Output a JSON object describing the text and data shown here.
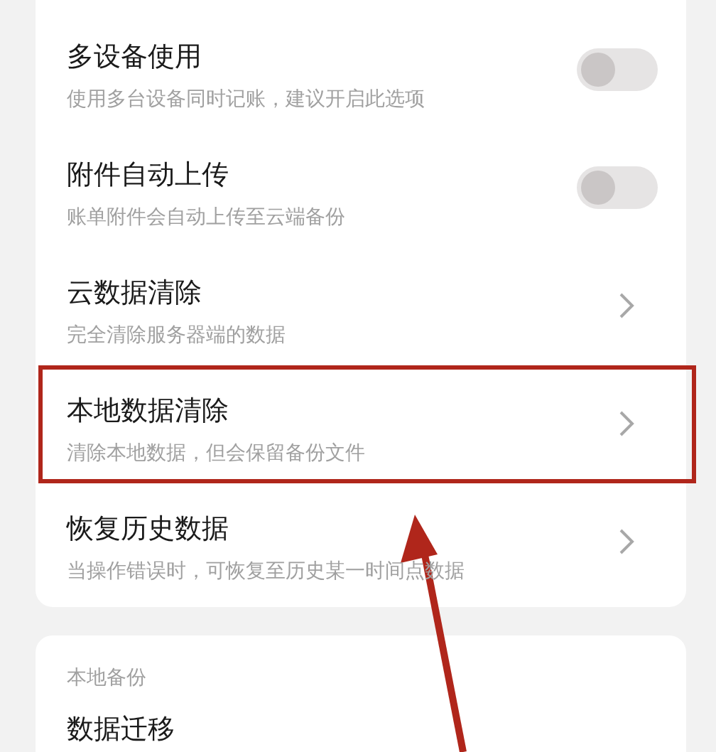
{
  "settings_rows": [
    {
      "kind": "toggle",
      "title": "多设备使用",
      "subtitle": "使用多台设备同时记账，建议开启此选项",
      "on": false,
      "highlighted": false
    },
    {
      "kind": "toggle",
      "title": "附件自动上传",
      "subtitle": "账单附件会自动上传至云端备份",
      "on": false,
      "highlighted": false
    },
    {
      "kind": "link",
      "title": "云数据清除",
      "subtitle": "完全清除服务器端的数据",
      "highlighted": false
    },
    {
      "kind": "link",
      "title": "本地数据清除",
      "subtitle": "清除本地数据，但会保留备份文件",
      "highlighted": true
    },
    {
      "kind": "link",
      "title": "恢复历史数据",
      "subtitle": "当操作错误时，可恢复至历史某一时间点数据",
      "highlighted": false
    }
  ],
  "local_backup": {
    "header": "本地备份",
    "rows": [
      {
        "title": "数据迁移"
      }
    ]
  }
}
